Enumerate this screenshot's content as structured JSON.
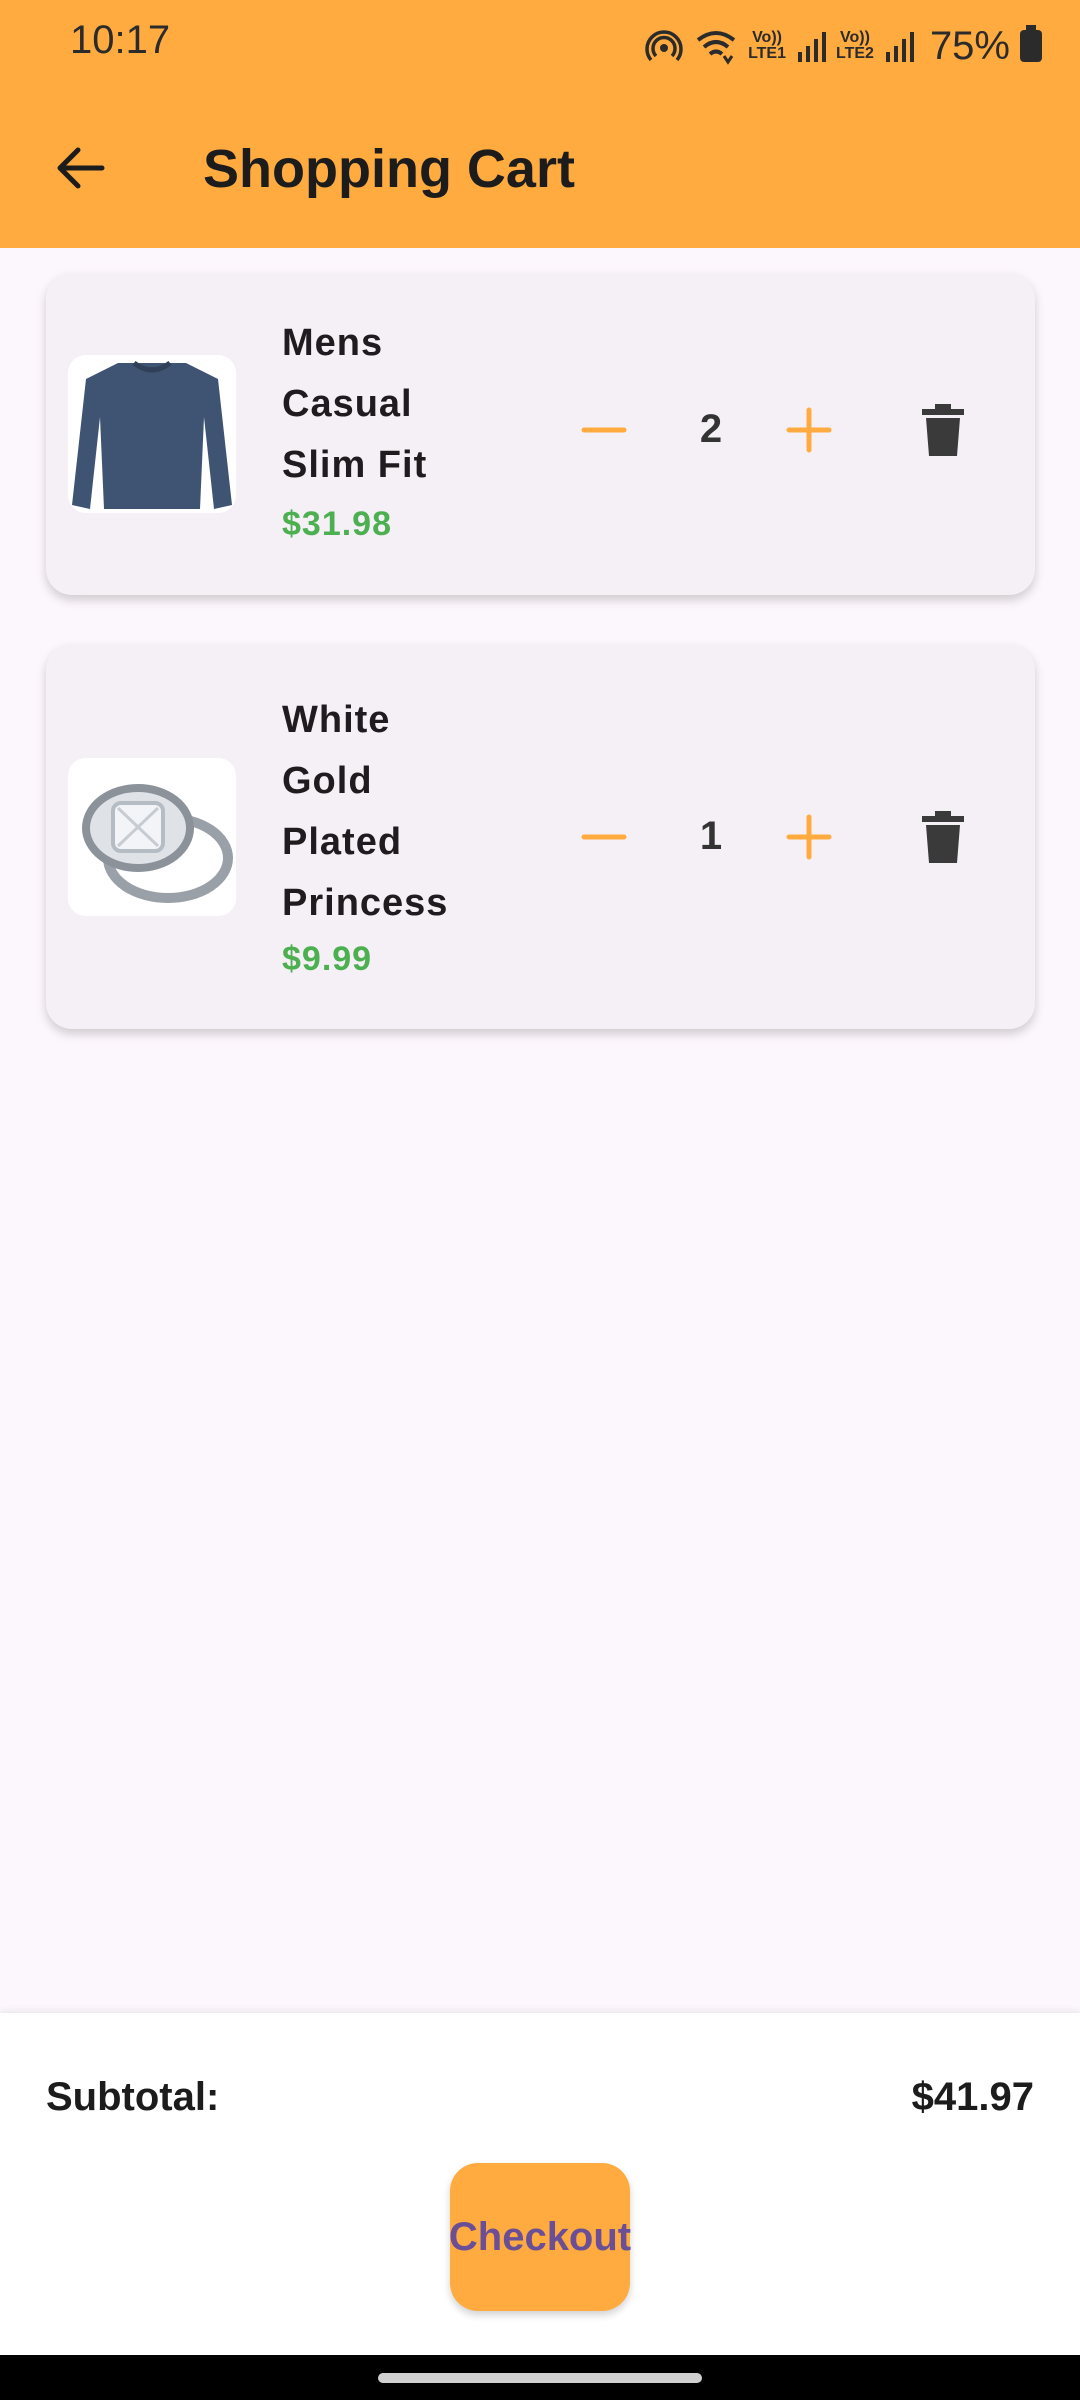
{
  "status_bar": {
    "time": "10:17",
    "battery_percent": "75%",
    "lte1": "Vo))\nLTE1",
    "lte2": "Vo))\nLTE2"
  },
  "app_bar": {
    "title": "Shopping Cart",
    "back_icon": "arrow-back-icon"
  },
  "cart": {
    "items": [
      {
        "name": "Mens Casual Slim Fit",
        "price": "$31.98",
        "quantity": "2",
        "image": "long-sleeve-shirt"
      },
      {
        "name": "White Gold Plated Princess",
        "price": "$9.99",
        "quantity": "1",
        "image": "diamond-ring"
      }
    ]
  },
  "summary": {
    "subtotal_label": "Subtotal:",
    "subtotal_value": "$41.97",
    "checkout_label": "Checkout"
  },
  "colors": {
    "accent": "#ffab40",
    "price_green": "#4caf50",
    "checkout_text": "#6a4f96",
    "card_bg": "#f4f0f6",
    "page_bg": "#fcf7fc"
  }
}
